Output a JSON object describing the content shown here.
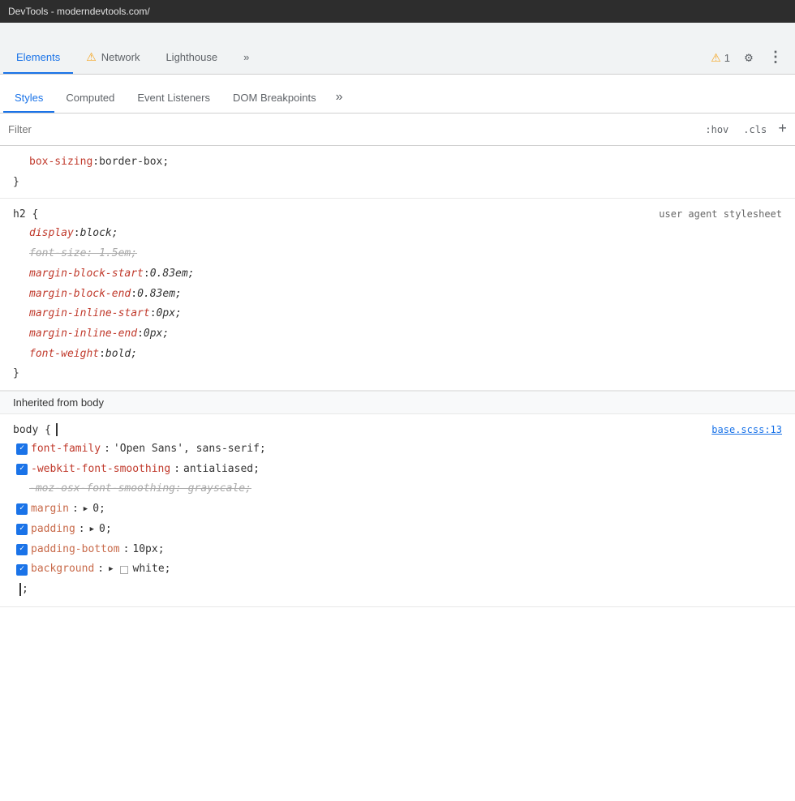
{
  "titlebar": {
    "text": "DevTools - moderndevtools.com/"
  },
  "topTabs": {
    "tabs": [
      {
        "label": "Elements",
        "active": true,
        "warning": false
      },
      {
        "label": "Network",
        "active": false,
        "warning": true
      },
      {
        "label": "Lighthouse",
        "active": false,
        "warning": false
      }
    ],
    "moreLabel": "»",
    "warningCount": "1",
    "gearIcon": "⚙",
    "moreIcon": "⋮"
  },
  "subTabs": {
    "tabs": [
      {
        "label": "Styles",
        "active": true
      },
      {
        "label": "Computed",
        "active": false
      },
      {
        "label": "Event Listeners",
        "active": false
      },
      {
        "label": "DOM Breakpoints",
        "active": false
      }
    ],
    "moreLabel": "»"
  },
  "filterBar": {
    "placeholder": "Filter",
    "hov": ":hov",
    "cls": ".cls",
    "plus": "+"
  },
  "sections": [
    {
      "id": "box-sizing-section",
      "selector": "",
      "source": "",
      "properties": [
        {
          "name": "box-sizing",
          "colon": ": ",
          "value": "border-box;",
          "strikethrough": false,
          "italic": false,
          "checkbox": false,
          "indented": true
        }
      ],
      "closeBrace": "}"
    },
    {
      "id": "h2-section",
      "selector": "h2 {",
      "source": "user agent stylesheet",
      "properties": [
        {
          "name": "display",
          "colon": ": ",
          "value": "block;",
          "strikethrough": false,
          "italic": true,
          "checkbox": false
        },
        {
          "name": "font-size: 1.5em;",
          "colon": "",
          "value": "",
          "strikethrough": true,
          "italic": true,
          "checkbox": false
        },
        {
          "name": "margin-block-start",
          "colon": ": ",
          "value": "0.83em;",
          "strikethrough": false,
          "italic": true,
          "checkbox": false
        },
        {
          "name": "margin-block-end",
          "colon": ": ",
          "value": "0.83em;",
          "strikethrough": false,
          "italic": true,
          "checkbox": false
        },
        {
          "name": "margin-inline-start",
          "colon": ": ",
          "value": "0px;",
          "strikethrough": false,
          "italic": true,
          "checkbox": false
        },
        {
          "name": "margin-inline-end",
          "colon": ": ",
          "value": "0px;",
          "strikethrough": false,
          "italic": true,
          "checkbox": false
        },
        {
          "name": "font-weight",
          "colon": ": ",
          "value": "bold;",
          "strikethrough": false,
          "italic": true,
          "checkbox": false
        }
      ],
      "closeBrace": "}"
    },
    {
      "id": "inherited-header",
      "label": "Inherited from  body"
    },
    {
      "id": "body-section",
      "selector": "body {",
      "source": "base.scss:13",
      "properties": [
        {
          "name": "font-family",
          "colon": ": ",
          "value": "'Open Sans', sans-serif;",
          "strikethrough": false,
          "italic": false,
          "checkbox": true,
          "checked": true
        },
        {
          "name": "-webkit-font-smoothing",
          "colon": ": ",
          "value": "antialiased;",
          "strikethrough": false,
          "italic": false,
          "checkbox": true,
          "checked": true
        },
        {
          "name": "-moz-osx-font-smoothing: grayscale;",
          "colon": "",
          "value": "",
          "strikethrough": true,
          "italic": false,
          "checkbox": false
        },
        {
          "name": "margin",
          "colon": ": ",
          "value": "0;",
          "strikethrough": false,
          "italic": false,
          "checkbox": true,
          "checked": true,
          "hasTriangle": true
        },
        {
          "name": "padding",
          "colon": ": ",
          "value": "0;",
          "strikethrough": false,
          "italic": false,
          "checkbox": true,
          "checked": true,
          "hasTriangle": true
        },
        {
          "name": "padding-bottom",
          "colon": ": ",
          "value": "10px;",
          "strikethrough": false,
          "italic": false,
          "checkbox": true,
          "checked": true
        },
        {
          "name": "background",
          "colon": ": ",
          "value": "white;",
          "strikethrough": false,
          "italic": false,
          "checkbox": true,
          "checked": true,
          "hasTriangle": true,
          "hasSwatch": true
        }
      ],
      "closeBrace": "",
      "cursorLine": true
    }
  ]
}
